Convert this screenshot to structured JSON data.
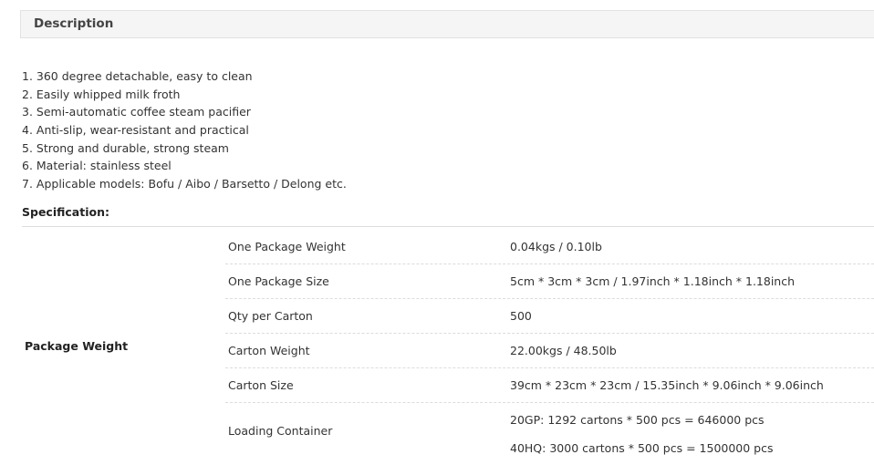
{
  "description": {
    "title": "Description"
  },
  "features": [
    "1. 360 degree detachable, easy to clean",
    "2. Easily whipped milk froth",
    "3. Semi-automatic coffee steam pacifier",
    "4. Anti-slip, wear-resistant and practical",
    "5. Strong and durable, strong steam",
    "6. Material: stainless steel",
    "7. Applicable models: Bofu / Aibo / Barsetto / Delong etc."
  ],
  "specification": {
    "title": "Specification:",
    "group_label": "Package Weight",
    "rows": [
      {
        "key": "One Package Weight",
        "value": "0.04kgs / 0.10lb"
      },
      {
        "key": "One Package Size",
        "value": "5cm * 3cm * 3cm / 1.97inch * 1.18inch * 1.18inch"
      },
      {
        "key": "Qty per Carton",
        "value": "500"
      },
      {
        "key": "Carton Weight",
        "value": "22.00kgs / 48.50lb"
      },
      {
        "key": "Carton Size",
        "value": "39cm * 23cm * 23cm / 15.35inch * 9.06inch * 9.06inch"
      }
    ],
    "loading": {
      "key": "Loading Container",
      "values": [
        "20GP: 1292 cartons * 500 pcs = 646000 pcs",
        "40HQ: 3000 cartons * 500 pcs = 1500000 pcs"
      ]
    }
  }
}
